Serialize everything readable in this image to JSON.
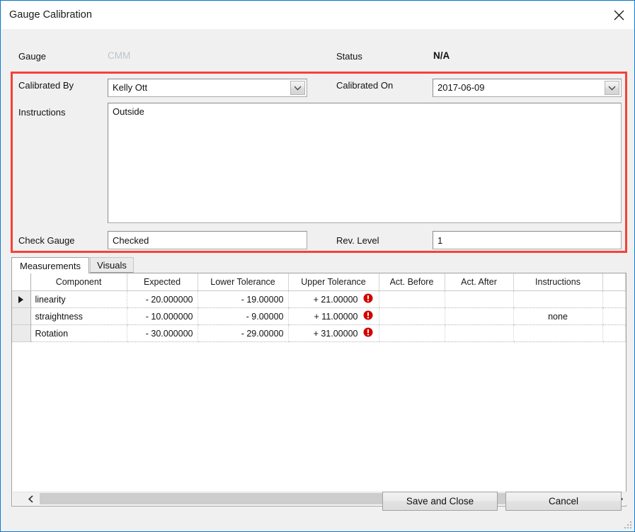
{
  "window": {
    "title": "Gauge Calibration",
    "close_icon": "close-icon",
    "accent_border": "#0c7cd5",
    "highlight_color": "#f44336"
  },
  "header": {
    "gauge_label": "Gauge",
    "gauge_value": "CMM",
    "status_label": "Status",
    "status_value": "N/A"
  },
  "form": {
    "calibrated_by_label": "Calibrated By",
    "calibrated_by_value": "Kelly Ott",
    "calibrated_on_label": "Calibrated On",
    "calibrated_on_value": "2017-06-09",
    "instructions_label": "Instructions",
    "instructions_value": "Outside",
    "check_gauge_label": "Check Gauge",
    "check_gauge_value": "Checked",
    "rev_level_label": "Rev. Level",
    "rev_level_value": "1"
  },
  "tabs": [
    {
      "label": "Measurements",
      "selected": true
    },
    {
      "label": "Visuals",
      "selected": false
    }
  ],
  "grid": {
    "columns": [
      "Component",
      "Expected",
      "Lower Tolerance",
      "Upper Tolerance",
      "Act. Before",
      "Act. After",
      "Instructions"
    ],
    "rows": [
      {
        "selected": true,
        "component": "linearity",
        "expected": "- 20.000000",
        "lower_tolerance": "- 19.00000",
        "upper_tolerance": "+ 21.00000",
        "upper_tolerance_icon": "error-icon",
        "act_before": "",
        "act_after": "",
        "instructions": ""
      },
      {
        "selected": false,
        "component": "straightness",
        "expected": "- 10.000000",
        "lower_tolerance": "- 9.00000",
        "upper_tolerance": "+ 11.00000",
        "upper_tolerance_icon": "error-icon",
        "act_before": "",
        "act_after": "",
        "instructions": "none"
      },
      {
        "selected": false,
        "component": "Rotation",
        "expected": "- 30.000000",
        "lower_tolerance": "- 29.00000",
        "upper_tolerance": "+ 31.00000",
        "upper_tolerance_icon": "error-icon",
        "act_before": "",
        "act_after": "",
        "instructions": ""
      }
    ],
    "scroll_left_icon": "chevron-left-icon",
    "scroll_right_icon": "chevron-right-icon"
  },
  "footer": {
    "save_label": "Save and Close",
    "cancel_label": "Cancel",
    "resize_grip_icon": "resize-grip-icon"
  }
}
